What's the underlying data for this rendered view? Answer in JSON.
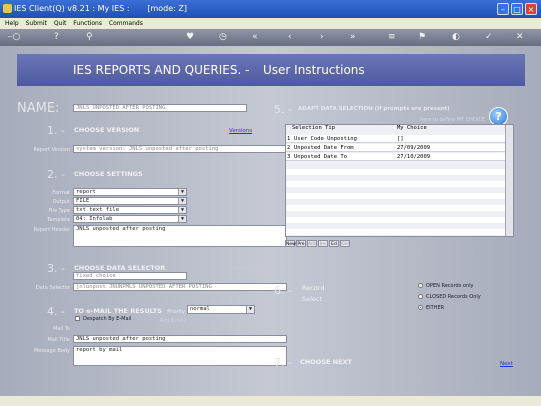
{
  "window": {
    "title": "IES Client(Q) v8.21 : My IES :       [mode: Z]"
  },
  "menu": [
    "Help",
    "Submit",
    "Quit",
    "Functions",
    "Commands"
  ],
  "toolbar_icons": [
    "key-icon",
    "help-icon",
    "search-icon",
    "heart-icon",
    "clock-icon",
    "rewind-icon",
    "back-icon",
    "forward-icon",
    "fast-forward-icon",
    "list-icon",
    "flag-icon",
    "globe-icon",
    "check-icon",
    "close-icon"
  ],
  "banner": {
    "title": "IES REPORTS AND QUERIES. -",
    "subtitle": "User Instructions"
  },
  "name": {
    "label": "NAME:",
    "value": "JNLS UNPOSTED AFTER POSTING"
  },
  "step1": {
    "num": "1. -",
    "title": "CHOOSE VERSION",
    "link": "Versions",
    "report_version_label": "Report Version",
    "report_version_value": "system version: JNLS unposted after posting"
  },
  "step2": {
    "num": "2. -",
    "title": "CHOOSE SETTINGS",
    "format_label": "Format",
    "format_value": "report",
    "output_label": "Output",
    "output_value": "FILE",
    "filetype_label": "File Type",
    "filetype_value": "txt text file",
    "template_label": "Template",
    "template_value": "04: Infolab",
    "header_label": "Report Header",
    "header_value": "JNLS unposted after posting"
  },
  "step3": {
    "num": "3. -",
    "title": "CHOOSE DATA SELECTOR",
    "hint": "selector management",
    "choice_value": "fixed choice",
    "selector_label": "Data Selector",
    "selector_value": "jnlunpost JNUNPMLS UNPOSTED AFTER POSTING"
  },
  "step4": {
    "num": "4. -",
    "title": "TO e-MAIL THE RESULTS",
    "priority_label": "Priority",
    "priority_value": "normal",
    "despatch_label": "Despatch By E-Mail",
    "add_email_label": "Add Email",
    "mail_to_label": "Mail To",
    "mail_title_label": "Mail Title",
    "mail_title_value": "JNLS unposted after posting",
    "body_label": "Message Body",
    "body_value": "report by mail"
  },
  "step5": {
    "num": "5. -",
    "title": "ADAPT DATA SELECTION (if prompts are present)",
    "hint": "here to define MY CHOICE",
    "col_tip": "Selection Tip",
    "col_choice": "My Choice",
    "rows": [
      {
        "n": "1",
        "tip": "User Code Unposting",
        "choice": "[]"
      },
      {
        "n": "2",
        "tip": "Unposted Date From",
        "choice": "27/09/2009"
      },
      {
        "n": "3",
        "tip": "Unposted Date To",
        "choice": "27/10/2009"
      }
    ],
    "nav": [
      "New",
      "Pre",
      "Add",
      "Ins",
      "Ed",
      "Del"
    ]
  },
  "step6": {
    "num": "6. -",
    "record_label": "Record",
    "select_label": "Select",
    "options": [
      "OPEN Records only",
      "CLOSED Records Only",
      "EITHER"
    ],
    "selected": "EITHER"
  },
  "step7": {
    "num": "7. -",
    "title": "CHOOSE NEXT",
    "next": "Next"
  }
}
